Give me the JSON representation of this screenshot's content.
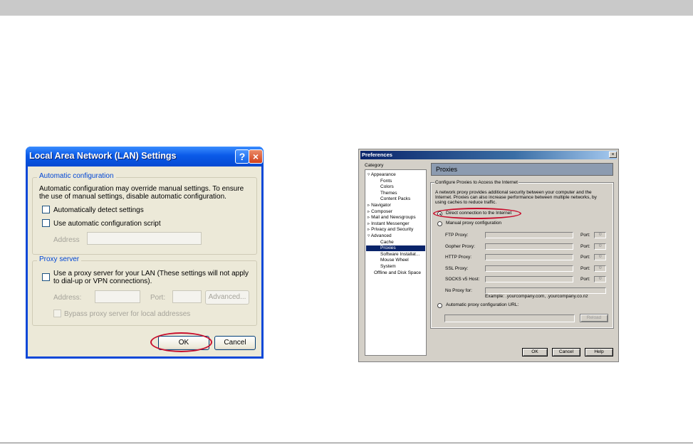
{
  "lan_dialog": {
    "title": "Local Area Network (LAN) Settings",
    "help_glyph": "?",
    "close_glyph": "×",
    "auto_group": "Automatic configuration",
    "auto_text": "Automatic configuration may override manual settings.  To ensure the use of manual settings, disable automatic configuration.",
    "auto_detect_label": "Automatically detect settings",
    "auto_script_label": "Use automatic configuration script",
    "address_label": "Address",
    "proxy_group": "Proxy server",
    "proxy_text": "Use a proxy server for your LAN (These settings will not apply to dial-up or VPN connections).",
    "proxy_address_label": "Address:",
    "port_label": "Port:",
    "advanced_label": "Advanced...",
    "bypass_label": "Bypass proxy server for local addresses",
    "ok_label": "OK",
    "cancel_label": "Cancel"
  },
  "pref_dialog": {
    "title": "Preferences",
    "close_glyph": "×",
    "category_label": "Category",
    "tree": [
      {
        "label": "▿ Appearance",
        "indent": 0
      },
      {
        "label": "Fonts",
        "indent": 2
      },
      {
        "label": "Colors",
        "indent": 2
      },
      {
        "label": "Themes",
        "indent": 2
      },
      {
        "label": "Content Packs",
        "indent": 2
      },
      {
        "label": "▹ Navigator",
        "indent": 0
      },
      {
        "label": "▹ Composer",
        "indent": 0
      },
      {
        "label": "▹ Mail and Newsgroups",
        "indent": 0
      },
      {
        "label": "▹ Instant Messenger",
        "indent": 0
      },
      {
        "label": "▹ Privacy and Security",
        "indent": 0
      },
      {
        "label": "▿ Advanced",
        "indent": 0
      },
      {
        "label": "Cache",
        "indent": 2
      },
      {
        "label": "Proxies",
        "indent": 2
      },
      {
        "label": "Software Installat...",
        "indent": 2
      },
      {
        "label": "Mouse Wheel",
        "indent": 2
      },
      {
        "label": "System",
        "indent": 2
      },
      {
        "label": "Offline and Disk Space",
        "indent": 1
      }
    ],
    "selected_index": 12,
    "panel_title": "Proxies",
    "group_label": "Configure Proxies to Access the Internet",
    "description": [
      "A network proxy provides additional security between your computer and the",
      "Internet. Proxies can also increase performance between multiple networks, by",
      "using caches to reduce traffic."
    ],
    "direct_label": "Direct connection to the Internet",
    "manual_label": "Manual proxy configuration",
    "proxy_rows": [
      {
        "label": "FTP Proxy:",
        "has_port": true
      },
      {
        "label": "Gopher Proxy:",
        "has_port": true
      },
      {
        "label": "HTTP Proxy:",
        "has_port": true
      },
      {
        "label": "SSL Proxy:",
        "has_port": true
      },
      {
        "label": "SOCKS v5 Host:",
        "has_port": true
      },
      {
        "label": "No Proxy for:",
        "has_port": false
      }
    ],
    "port_label": "Port:",
    "port_value": "0",
    "example_text": "Example: .yourcompany.com, .yourcompany.co.nz",
    "auto_label": "Automatic proxy configuration URL:",
    "reload_label": "Reload",
    "ok_label": "OK",
    "cancel_label": "Cancel",
    "help_label": "Help"
  },
  "colors": {
    "highlight_ring": "#c8102e",
    "xp_title_blue": "#0a5ae8",
    "classic_title": "#0a246a"
  }
}
